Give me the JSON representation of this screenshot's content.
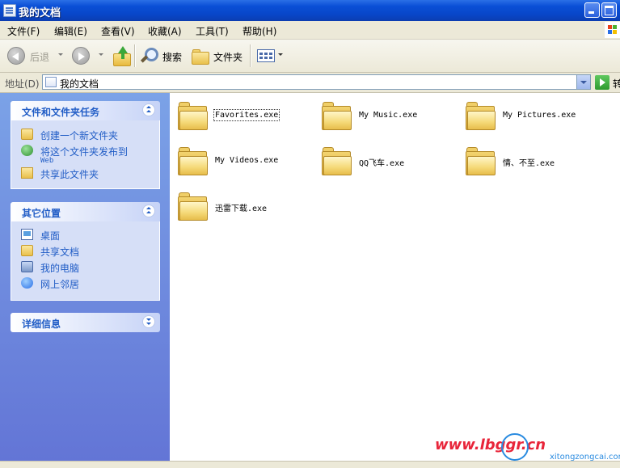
{
  "window": {
    "title": "我的文档"
  },
  "menu": [
    "文件(F)",
    "编辑(E)",
    "查看(V)",
    "收藏(A)",
    "工具(T)",
    "帮助(H)"
  ],
  "toolbar": {
    "back": "后退",
    "search": "搜索",
    "folders": "文件夹"
  },
  "address": {
    "label": "地址(D)",
    "value": "我的文档",
    "go": "转到"
  },
  "tasks": {
    "title": "文件和文件夹任务",
    "items": [
      {
        "label": "创建一个新文件夹",
        "icon": "new-folder-icon"
      },
      {
        "label": "将这个文件夹发布到",
        "label2": "Web",
        "icon": "publish-web-icon"
      },
      {
        "label": "共享此文件夹",
        "icon": "share-folder-icon"
      }
    ]
  },
  "places": {
    "title": "其它位置",
    "items": [
      {
        "label": "桌面",
        "icon": "desktop-icon"
      },
      {
        "label": "共享文档",
        "icon": "shared-documents-icon"
      },
      {
        "label": "我的电脑",
        "icon": "my-computer-icon"
      },
      {
        "label": "网上邻居",
        "icon": "network-places-icon"
      }
    ]
  },
  "details": {
    "title": "详细信息"
  },
  "files": [
    {
      "name": "Favorites.exe",
      "icon": "folder-icon"
    },
    {
      "name": "My Music.exe",
      "icon": "folder-icon"
    },
    {
      "name": "My Pictures.exe",
      "icon": "folder-icon"
    },
    {
      "name": "My Videos.exe",
      "icon": "folder-icon"
    },
    {
      "name": "QQ飞车.exe",
      "icon": "folder-icon"
    },
    {
      "name": "情、不至.exe",
      "icon": "folder-icon"
    },
    {
      "name": "迅雷下载.exe",
      "icon": "folder-icon"
    }
  ],
  "watermark": {
    "url": "www.lbggr.cn",
    "site": "xitongzongcai.com"
  },
  "colors": {
    "titlebar": "#0a4fd6",
    "taskpane": "#7ba2e7",
    "task_text": "#215dc6",
    "watermark": "#e8253a"
  }
}
